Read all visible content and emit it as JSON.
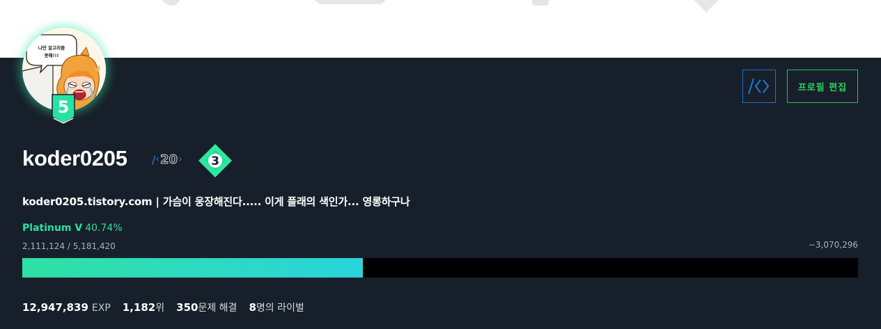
{
  "profile": {
    "avatar_caption": "나만 알고리즘 못해!!!",
    "tier_level": "5",
    "username": "koder0205",
    "ac_rating": "20",
    "class": "3",
    "bio": "koder0205.tistory.com | 가슴이 웅장해진다..... 이게 플래의 색인가... 영롱하구나",
    "tier_name": "Platinum V",
    "tier_percent": "40.74%",
    "progress_fraction": 0.4074,
    "rating_range": "2,111,124 / 5,181,420",
    "rating_diff": "−3,070,296"
  },
  "buttons": {
    "edit_profile": "프로필 편집"
  },
  "stats": {
    "exp_value": "12,947,839",
    "exp_label": "EXP",
    "rank_value": "1,182",
    "rank_label": "위",
    "solved_value": "350",
    "solved_label": "문제 해결",
    "rivals_value": "8",
    "rivals_label": "명의 라이벌"
  },
  "colors": {
    "panel_bg": "#17202a",
    "platinum": "#27e2a4",
    "ac_blue": "#1f7ad6",
    "edit_green": "#29c24d",
    "bar_track": "#000000"
  },
  "icons": [
    "tier-badge-icon",
    "code-brackets-icon",
    "class-diamond-icon"
  ]
}
